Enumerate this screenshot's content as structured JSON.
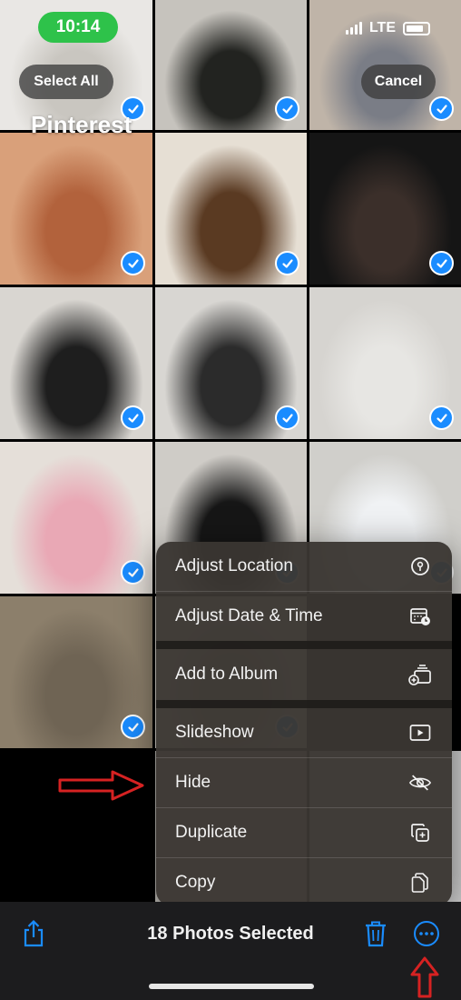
{
  "status_bar": {
    "time": "10:14",
    "network": "LTE"
  },
  "header": {
    "select_all_label": "Select All",
    "cancel_label": "Cancel",
    "album_title": "Pinterest"
  },
  "photos": [
    {
      "colors": [
        "#e9e7e4",
        "#c9c6c0"
      ]
    },
    {
      "colors": [
        "#c6c3bd",
        "#222320"
      ]
    },
    {
      "colors": [
        "#bfb4a8",
        "#7a7d86"
      ]
    },
    {
      "colors": [
        "#d9a07a",
        "#b2623c"
      ]
    },
    {
      "colors": [
        "#e6dfd4",
        "#5a3a22"
      ]
    },
    {
      "colors": [
        "#151515",
        "#3b2f2a"
      ]
    },
    {
      "colors": [
        "#d9d6d1",
        "#1e1e1e"
      ]
    },
    {
      "colors": [
        "#d8d6d2",
        "#2b2b2b"
      ]
    },
    {
      "colors": [
        "#d6d4d0",
        "#e7e6e3"
      ]
    },
    {
      "colors": [
        "#e5dfd9",
        "#e9a8b5"
      ]
    },
    {
      "colors": [
        "#cfccc7",
        "#161616"
      ]
    },
    {
      "colors": [
        "#d0cfcb",
        "#f0f2f4"
      ]
    },
    {
      "colors": [
        "#8c7f6b",
        "#6f6454"
      ]
    },
    {
      "colors": [
        "#ddd8d0",
        "#b8ad96"
      ]
    }
  ],
  "menu": {
    "items": [
      {
        "label": "Adjust Location",
        "icon": "info-location-icon"
      },
      {
        "label": "Adjust Date & Time",
        "icon": "calendar-clock-icon"
      },
      {
        "label": "Add to Album",
        "icon": "add-to-album-icon"
      },
      {
        "label": "Slideshow",
        "icon": "play-icon"
      },
      {
        "label": "Hide",
        "icon": "eye-slash-icon"
      },
      {
        "label": "Duplicate",
        "icon": "duplicate-icon"
      },
      {
        "label": "Copy",
        "icon": "copy-icon"
      }
    ]
  },
  "toolbar": {
    "selection_label": "18 Photos Selected"
  },
  "colors": {
    "accent": "#1a8cff",
    "annotation": "#d62222"
  }
}
